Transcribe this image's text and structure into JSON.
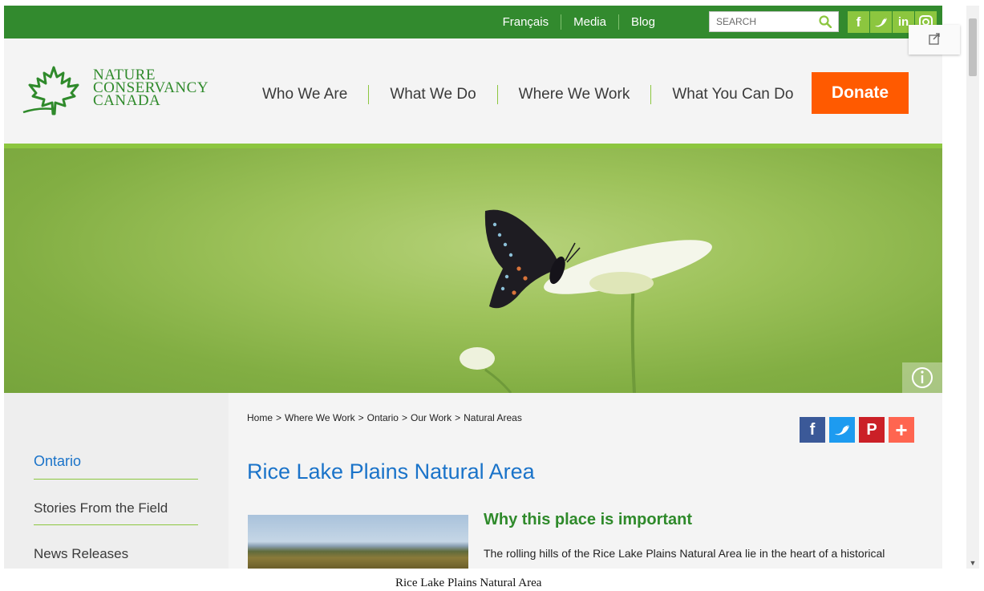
{
  "topbar": {
    "links": [
      "Français",
      "Media",
      "Blog"
    ],
    "search_placeholder": "SEARCH",
    "social": [
      "facebook-icon",
      "twitter-icon",
      "linkedin-icon",
      "instagram-icon"
    ]
  },
  "logo": {
    "lines": [
      "NATURE",
      "CONSERVANCY",
      "CANADA"
    ]
  },
  "nav": {
    "items": [
      "Who We Are",
      "What We Do",
      "Where We Work",
      "What You Can Do"
    ],
    "donate": "Donate"
  },
  "sidebar": {
    "items": [
      "Ontario",
      "Stories From the Field",
      "News Releases"
    ]
  },
  "breadcrumb": [
    "Home",
    "Where We Work",
    "Ontario",
    "Our Work",
    "Natural Areas"
  ],
  "breadcrumb_sep": ">",
  "share": [
    "facebook-icon",
    "twitter-icon",
    "pinterest-icon",
    "plus-icon"
  ],
  "page": {
    "title": "Rice Lake Plains Natural Area",
    "section_heading": "Why this place is important",
    "intro": "The rolling hills of the Rice Lake Plains Natural Area lie in the heart of a historical",
    "caption": "Rice Lake Plains Natural Area"
  },
  "colors": {
    "brand_green": "#328a2e",
    "accent_green": "#8cc63f",
    "donate": "#ff5a00",
    "title_blue": "#1a73c9"
  }
}
